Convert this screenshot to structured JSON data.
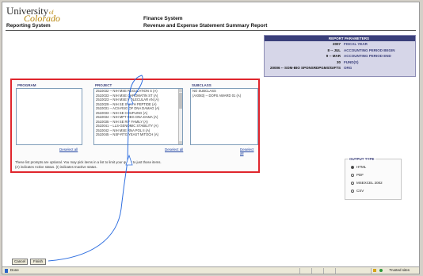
{
  "header": {
    "brand_university": "University",
    "brand_of": "of",
    "brand_colorado": "Colorado",
    "system_left": "Reporting System",
    "system_title": "Finance System",
    "report_title": "Revenue and Expense Statement Summary Report"
  },
  "report_parameters": {
    "heading": "REPORT PARAMETERS",
    "rows": [
      {
        "value": "2007",
        "label": "FISCAL YEAR"
      },
      {
        "value": "8 -- JUL",
        "label": "ACCOUNTING PERIOD BEGIN"
      },
      {
        "value": "9 -- MAR",
        "label": "ACCOUNTING PERIOD END"
      },
      {
        "value": "30",
        "label": "FUND(S)"
      },
      {
        "value": "20006 -- SOM-BIO SPONSRDPGMS/GIFTS",
        "label": "ORG"
      }
    ]
  },
  "prompts": {
    "program": {
      "label": "PROGRAM",
      "deselect": "Deselect all",
      "items": []
    },
    "project": {
      "label": "PROJECT",
      "deselect": "Deselect all",
      "items": [
        "2510032 -- NIH MSE REGULATION S (A)",
        "2510033 -- NIH MSE CHROMATIN ST (A)",
        "2510023 -- NIH MSE MOLECULAR AN (A)",
        "2510029 -- NIH SE SYNTH PEPTIDE (A)",
        "2510031 -- ACS-RSG OF DNA DAMAG (A)",
        "2510033 -- NIH SE COUPLING (A)",
        "2510034 -- NIH MPT REG DNA DAMA (A)",
        "2510035 -- NIH SE RIF FAMILY (A)",
        "2510041 -- LLS-GENOMIC STABILITY (A)",
        "2510042 -- NIH MSE RNA POL II (A)",
        "2510045 -- NSF-RTG YEAST MITOCH (A)"
      ]
    },
    "subclass": {
      "label": "SUBCLASS",
      "deselect": "Deselect all",
      "items": [
        "NO SUBCLASS",
        "(AX083) -- DOPS AWARD 01 (A)"
      ]
    },
    "footnote_line1": "These list prompts are optional.  You may pick items in a list to limit your query to just those items.",
    "footnote_line2": "(A) indicates Active status.  (I) indicates Inactive status."
  },
  "output_type": {
    "label": "OUTPUT TYPE",
    "options": [
      {
        "label": "HTML",
        "selected": true
      },
      {
        "label": "PDF",
        "selected": false
      },
      {
        "label": "MSEXCEL 2002",
        "selected": false
      },
      {
        "label": "CSV",
        "selected": false
      }
    ]
  },
  "buttons": {
    "cancel": "Cancel",
    "finish": "Finish"
  },
  "statusbar": {
    "left": "Done",
    "zone": "Trusted sites"
  },
  "colors": {
    "highlight_box": "#e0262d",
    "params_header": "#3a3f7a",
    "annotation_arrow": "#2f6fe0"
  }
}
